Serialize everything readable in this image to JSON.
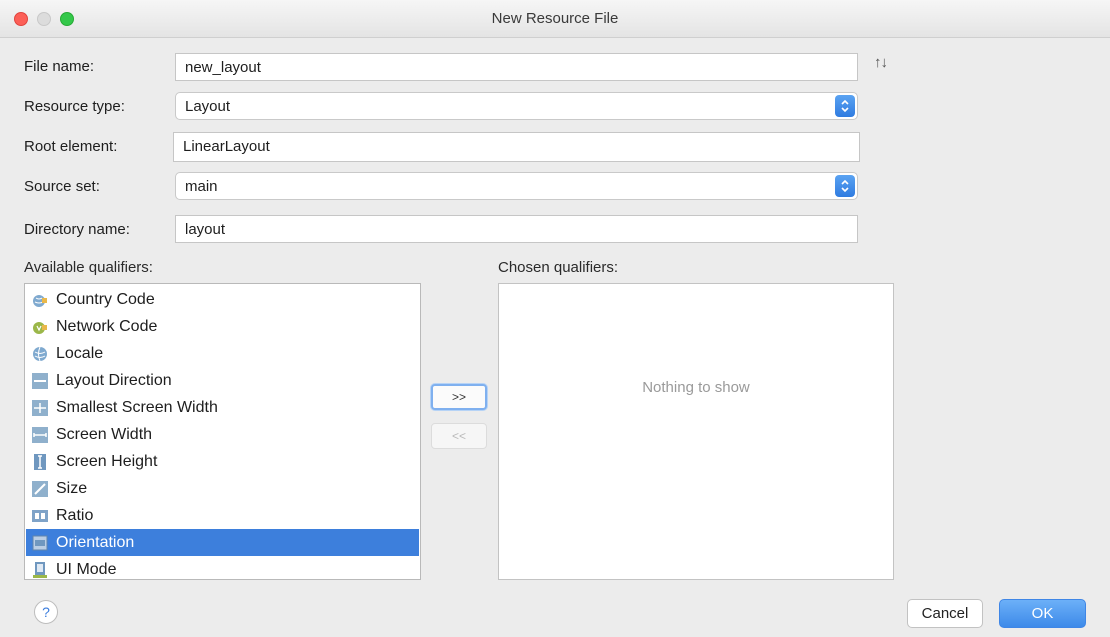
{
  "window": {
    "title": "New Resource File"
  },
  "form": {
    "file_name": {
      "label": "File name:",
      "value": "new_layout"
    },
    "resource_type": {
      "label": "Resource type:",
      "value": "Layout"
    },
    "root_element": {
      "label": "Root element:",
      "value": "LinearLayout"
    },
    "source_set": {
      "label": "Source set:",
      "value": "main"
    },
    "directory_name": {
      "label": "Directory name:",
      "value": "layout"
    },
    "swap_icon": "↑↓"
  },
  "qualifiers": {
    "available_label": "Available qualifiers:",
    "chosen_label": "Chosen qualifiers:",
    "available": [
      {
        "label": "Country Code",
        "icon": "globe-flag-icon"
      },
      {
        "label": "Network Code",
        "icon": "network-icon"
      },
      {
        "label": "Locale",
        "icon": "globe-icon"
      },
      {
        "label": "Layout Direction",
        "icon": "layout-direction-icon"
      },
      {
        "label": "Smallest Screen Width",
        "icon": "smallest-width-icon"
      },
      {
        "label": "Screen Width",
        "icon": "screen-width-icon"
      },
      {
        "label": "Screen Height",
        "icon": "screen-height-icon"
      },
      {
        "label": "Size",
        "icon": "size-icon"
      },
      {
        "label": "Ratio",
        "icon": "ratio-icon"
      },
      {
        "label": "Orientation",
        "icon": "orientation-icon",
        "selected": true
      },
      {
        "label": "UI Mode",
        "icon": "ui-mode-icon"
      }
    ],
    "chosen_empty_text": "Nothing to show",
    "add_button": ">>",
    "remove_button": "<<"
  },
  "footer": {
    "help_label": "?",
    "cancel_label": "Cancel",
    "ok_label": "OK"
  },
  "colors": {
    "selection": "#3d7fdc",
    "accent": "#3d8ae9"
  }
}
